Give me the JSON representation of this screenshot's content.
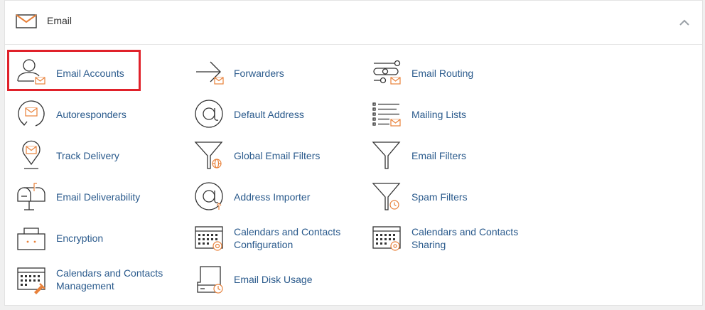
{
  "section": {
    "title": "Email",
    "collapse_icon": "chevron-up-icon",
    "header_icon": "envelope-icon"
  },
  "colors": {
    "link": "#2a5a8c",
    "accent": "#e8813a",
    "highlight": "#e0212a"
  },
  "items": [
    {
      "label": "Email Accounts",
      "icon": "user-mail-icon"
    },
    {
      "label": "Forwarders",
      "icon": "forward-arrow-icon"
    },
    {
      "label": "Email Routing",
      "icon": "routing-icon"
    },
    {
      "label": "Autoresponders",
      "icon": "autoresponder-icon"
    },
    {
      "label": "Default Address",
      "icon": "at-sign-icon"
    },
    {
      "label": "Mailing Lists",
      "icon": "mailing-list-icon"
    },
    {
      "label": "Track Delivery",
      "icon": "location-pin-icon"
    },
    {
      "label": "Global Email Filters",
      "icon": "global-filter-icon"
    },
    {
      "label": "Email Filters",
      "icon": "filter-icon"
    },
    {
      "label": "Email Deliverability",
      "icon": "mailbox-icon"
    },
    {
      "label": "Address Importer",
      "icon": "import-icon"
    },
    {
      "label": "Spam Filters",
      "icon": "spam-filter-icon"
    },
    {
      "label": "Encryption",
      "icon": "lock-icon"
    },
    {
      "label_line1": "Calendars and Contacts",
      "label_line2": "Configuration",
      "icon": "calendar-config-icon"
    },
    {
      "label_line1": "Calendars and Contacts",
      "label_line2": "Sharing",
      "icon": "calendar-share-icon"
    },
    {
      "label_line1": "Calendars and Contacts",
      "label_line2": "Management",
      "icon": "calendar-manage-icon"
    },
    {
      "label": "Email Disk Usage",
      "icon": "disk-usage-icon"
    }
  ]
}
